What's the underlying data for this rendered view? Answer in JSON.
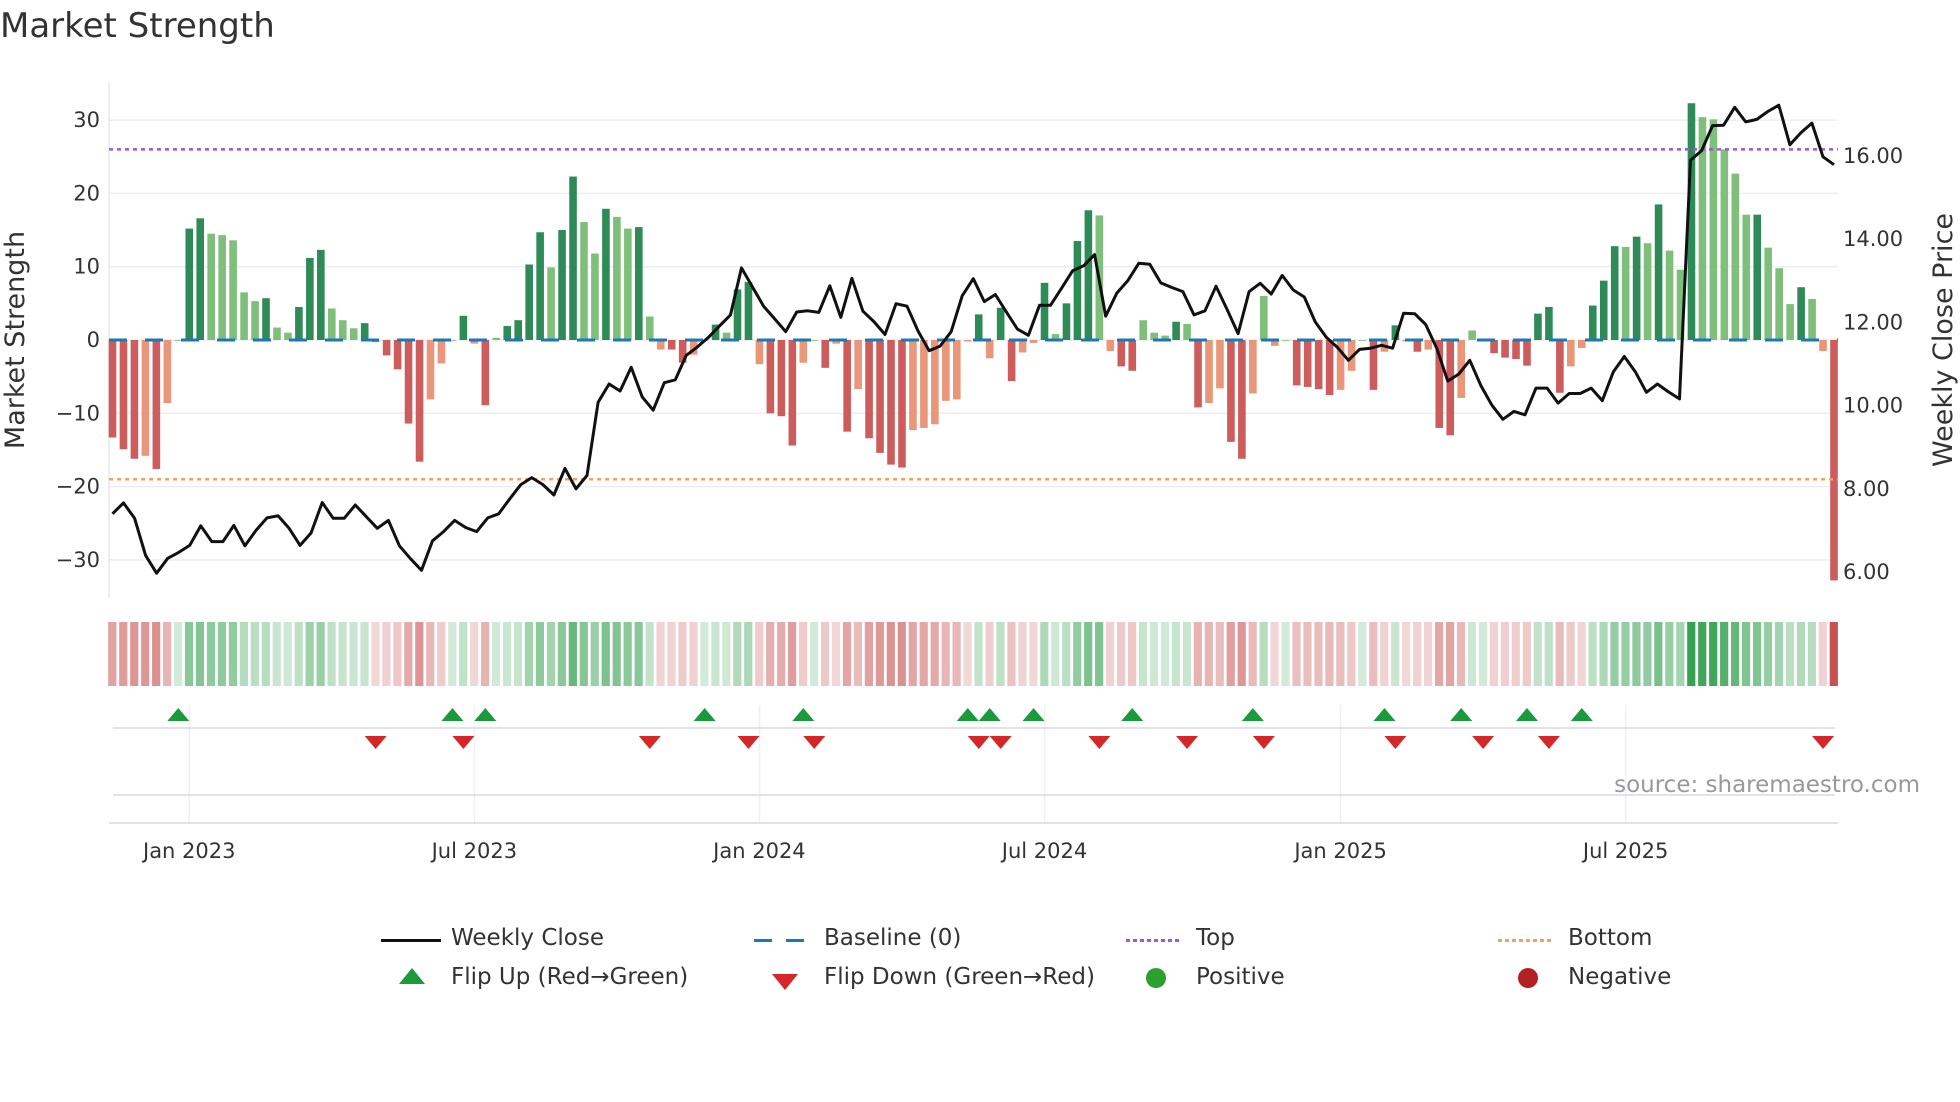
{
  "title": "Market Strength",
  "source": "source: sharemaestro.com",
  "chart_data": {
    "type": "bar",
    "title": "Market Strength",
    "ylabel": "Market Strength",
    "y2label": "Weekly Close Price",
    "ylim": [
      -35,
      35
    ],
    "y2lim": [
      5.0,
      17.8
    ],
    "yticks": [
      "30",
      "20",
      "10",
      "0",
      "−10",
      "−20",
      "−30"
    ],
    "ytick_values": [
      30,
      20,
      10,
      0,
      -10,
      -20,
      -30
    ],
    "y2ticks": [
      "16.00",
      "14.00",
      "12.00",
      "10.00",
      "8.00",
      "6.00"
    ],
    "y2tick_values": [
      16,
      14,
      12,
      10,
      8,
      6
    ],
    "xticks": [
      "Jan 2023",
      "Jul 2023",
      "Jan 2024",
      "Jul 2024",
      "Jan 2025",
      "Jul 2025"
    ],
    "xtick_week_index": [
      7,
      33,
      59,
      85,
      112,
      138
    ],
    "top_level": 26,
    "bottom_level": -19,
    "baseline": 0,
    "strength": [
      -13.3,
      -14.9,
      -16.2,
      -15.8,
      -17.6,
      -8.6,
      0,
      15.2,
      16.6,
      14.5,
      14.3,
      13.6,
      6.5,
      5.3,
      5.7,
      1.7,
      1.0,
      4.5,
      11.2,
      12.3,
      4.3,
      2.7,
      1.6,
      2.3,
      -0.3,
      -2.1,
      -4.0,
      -11.4,
      -16.6,
      -8.1,
      -3.2,
      0,
      3.3,
      -0.5,
      -8.9,
      0.3,
      1.9,
      2.7,
      10.3,
      14.7,
      9.9,
      15.0,
      22.3,
      16.1,
      11.8,
      17.9,
      16.8,
      15.2,
      15.4,
      3.2,
      -1.3,
      -1.3,
      -3.1,
      -2.0,
      0,
      2.1,
      1.0,
      6.9,
      7.9,
      -3.3,
      -10.0,
      -10.4,
      -14.4,
      -3.1,
      0,
      -3.8,
      -0.5,
      -12.5,
      -6.7,
      -13.4,
      -15.4,
      -17.0,
      -17.4,
      -12.3,
      -12.0,
      -11.5,
      -8.3,
      -8.1,
      -0.2,
      3.5,
      -2.5,
      4.4,
      -5.6,
      -1.7,
      -0.4,
      7.8,
      0.8,
      5.0,
      13.5,
      17.7,
      17.0,
      -1.5,
      -3.6,
      -4.2,
      2.7,
      1.0,
      0.6,
      2.5,
      2.2,
      -9.2,
      -8.6,
      -6.6,
      -13.9,
      -16.2,
      -7.3,
      6.0,
      -0.8,
      0,
      -6.2,
      -6.4,
      -6.7,
      -7.5,
      -6.8,
      -4.2,
      0,
      -6.8,
      -1.6,
      2.0,
      -0.2,
      -1.6,
      -1.3,
      -12.0,
      -13.0,
      -7.9,
      1.3,
      0,
      -1.8,
      -2.4,
      -2.6,
      -3.5,
      3.6,
      4.5,
      -7.2,
      -3.6,
      -1.1,
      4.7,
      8.1,
      12.8,
      12.7,
      14.1,
      13.2,
      18.5,
      12.2,
      9.6,
      32.3,
      30.4,
      30.1,
      26.0,
      22.7,
      17.1,
      17.1,
      12.6,
      9.8,
      4.9,
      7.2,
      5.6,
      -1.5,
      -32.8
    ],
    "weekly_close": [
      7.4,
      7.66,
      7.29,
      6.4,
      5.97,
      6.33,
      6.47,
      6.64,
      7.11,
      6.73,
      6.73,
      7.12,
      6.63,
      7.0,
      7.3,
      7.35,
      7.05,
      6.64,
      6.94,
      7.67,
      7.29,
      7.29,
      7.61,
      7.33,
      7.05,
      7.24,
      6.63,
      6.32,
      6.04,
      6.75,
      6.97,
      7.24,
      7.07,
      6.97,
      7.3,
      7.4,
      7.76,
      8.1,
      8.27,
      8.1,
      7.85,
      8.49,
      8.0,
      8.32,
      10.08,
      10.52,
      10.35,
      10.92,
      10.21,
      9.89,
      10.55,
      10.62,
      11.21,
      11.41,
      11.64,
      11.91,
      12.18,
      13.31,
      12.85,
      12.39,
      12.09,
      11.78,
      12.25,
      12.28,
      12.24,
      12.88,
      12.12,
      13.06,
      12.27,
      12.02,
      11.71,
      12.45,
      12.39,
      11.79,
      11.32,
      11.43,
      11.78,
      12.64,
      13.05,
      12.5,
      12.67,
      12.25,
      11.84,
      11.69,
      12.41,
      12.41,
      12.82,
      13.24,
      13.36,
      13.63,
      12.15,
      12.7,
      13.0,
      13.42,
      13.4,
      12.95,
      12.84,
      12.74,
      12.18,
      12.28,
      12.87,
      12.31,
      11.73,
      12.74,
      12.94,
      12.68,
      13.13,
      12.78,
      12.61,
      12.01,
      11.64,
      11.4,
      11.09,
      11.35,
      11.38,
      11.45,
      11.38,
      12.22,
      12.21,
      11.95,
      11.38,
      10.59,
      10.76,
      11.09,
      10.48,
      10.01,
      9.67,
      9.86,
      9.78,
      10.42,
      10.42,
      10.06,
      10.29,
      10.29,
      10.42,
      10.12,
      10.81,
      11.18,
      10.81,
      10.32,
      10.52,
      10.33,
      10.16,
      15.9,
      16.13,
      16.73,
      16.74,
      17.17,
      16.82,
      16.88,
      17.07,
      17.22,
      16.27,
      16.56,
      16.79,
      15.98,
      15.79
    ],
    "flip_up_week_index": [
      6,
      31,
      34,
      54,
      63,
      78,
      80,
      84,
      93,
      104,
      116,
      123,
      129,
      134
    ],
    "flip_down_week_index": [
      24,
      32,
      49,
      58,
      64,
      79,
      81,
      90,
      98,
      105,
      117,
      125,
      131,
      156
    ],
    "colors": {
      "strong_positive": "#2e8b57",
      "weakening_positive": "#7fbf7b",
      "strong_negative": "#cd5c5c",
      "weakening_negative": "#e9967a",
      "line": "#111111",
      "baseline": "#1f77b4",
      "top": "#9b59d6",
      "bottom": "#f0a35e",
      "flip_up": "#1a9a3a",
      "flip_down": "#d62728",
      "positive": "#2ca02c",
      "negative": "#b22222"
    },
    "legend": [
      {
        "label": "Weekly Close",
        "icon": "solid-line"
      },
      {
        "label": "Baseline (0)",
        "icon": "dashed-line"
      },
      {
        "label": "Top",
        "icon": "dotted-line-purple"
      },
      {
        "label": "Bottom",
        "icon": "dotted-line-orange"
      },
      {
        "label": "Flip Up (Red→Green)",
        "icon": "triangle-up"
      },
      {
        "label": "Flip Down (Green→Red)",
        "icon": "triangle-down"
      },
      {
        "label": "Positive",
        "icon": "dot-green"
      },
      {
        "label": "Negative",
        "icon": "dot-red"
      }
    ],
    "legend_position": "bottom"
  }
}
